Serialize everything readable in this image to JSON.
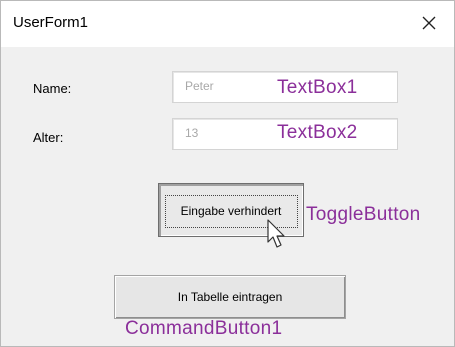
{
  "window": {
    "title": "UserForm1",
    "close_glyph": "close-icon"
  },
  "form": {
    "name_label": "Name:",
    "name_value": "Peter",
    "age_label": "Alter:",
    "age_value": "13",
    "toggle_caption": "Eingabe verhindert",
    "toggle_state": "pressed",
    "command_caption": "In Tabelle eintragen"
  },
  "annotations": {
    "textbox1": "TextBox1",
    "textbox2": "TextBox2",
    "toggle": "ToggleButton",
    "command": "CommandButton1"
  },
  "colors": {
    "annotation": "#8b2f9a",
    "disabled_text": "#a8a8a8"
  }
}
